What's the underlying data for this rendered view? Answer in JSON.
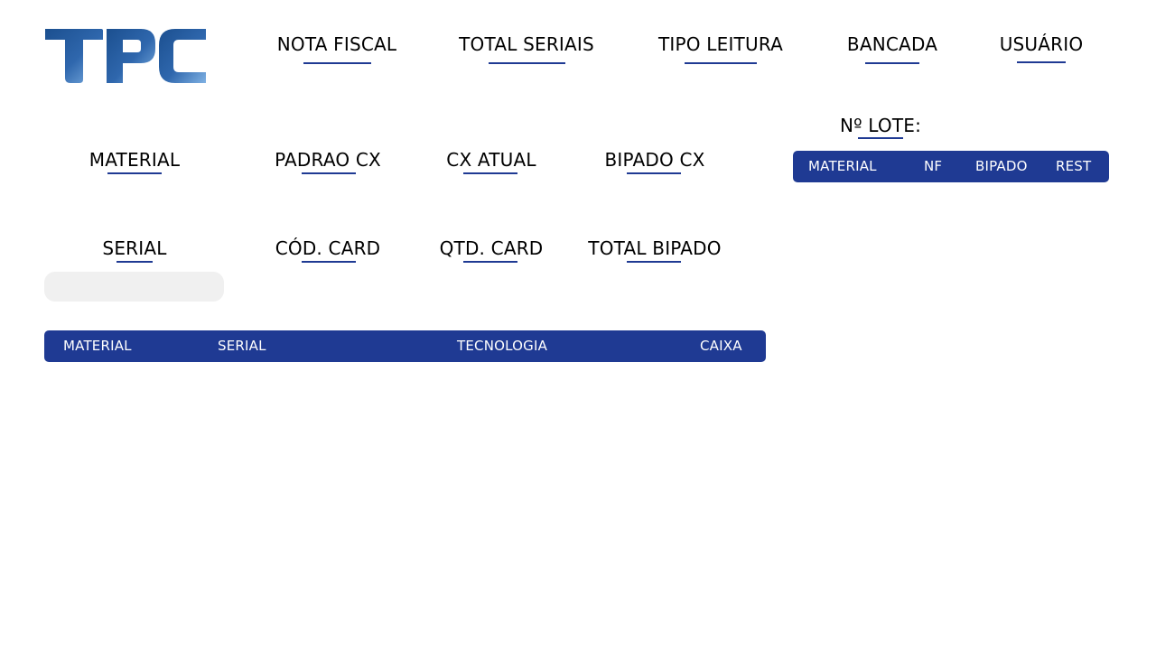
{
  "logo": {
    "text": "TPC",
    "colors": [
      "#1b4f8f",
      "#3a78c2",
      "#7fb1e3"
    ]
  },
  "header": {
    "fields": [
      {
        "label": "NOTA FISCAL"
      },
      {
        "label": "TOTAL SERIAIS"
      },
      {
        "label": "TIPO LEITURA"
      },
      {
        "label": "BANCADA"
      },
      {
        "label": "USUÁRIO"
      }
    ]
  },
  "box_fields": [
    {
      "label": "MATERIAL"
    },
    {
      "label": "PADRAO CX"
    },
    {
      "label": "CX ATUAL"
    },
    {
      "label": "BIPADO CX"
    }
  ],
  "card_fields": [
    {
      "label": "SERIAL"
    },
    {
      "label": "CÓD. CARD"
    },
    {
      "label": "QTD. CARD"
    },
    {
      "label": "TOTAL BIPADO"
    }
  ],
  "lote": {
    "label": "Nº LOTE:",
    "table_headers": [
      "MATERIAL",
      "NF",
      "BIPADO",
      "REST"
    ]
  },
  "serial_input": {
    "value": "",
    "placeholder": ""
  },
  "main_table": {
    "headers": [
      "MATERIAL",
      "SERIAL",
      "TECNOLOGIA",
      "CAIXA"
    ]
  },
  "colors": {
    "accent": "#1f3a93",
    "input_bg": "#f0f0f0"
  }
}
